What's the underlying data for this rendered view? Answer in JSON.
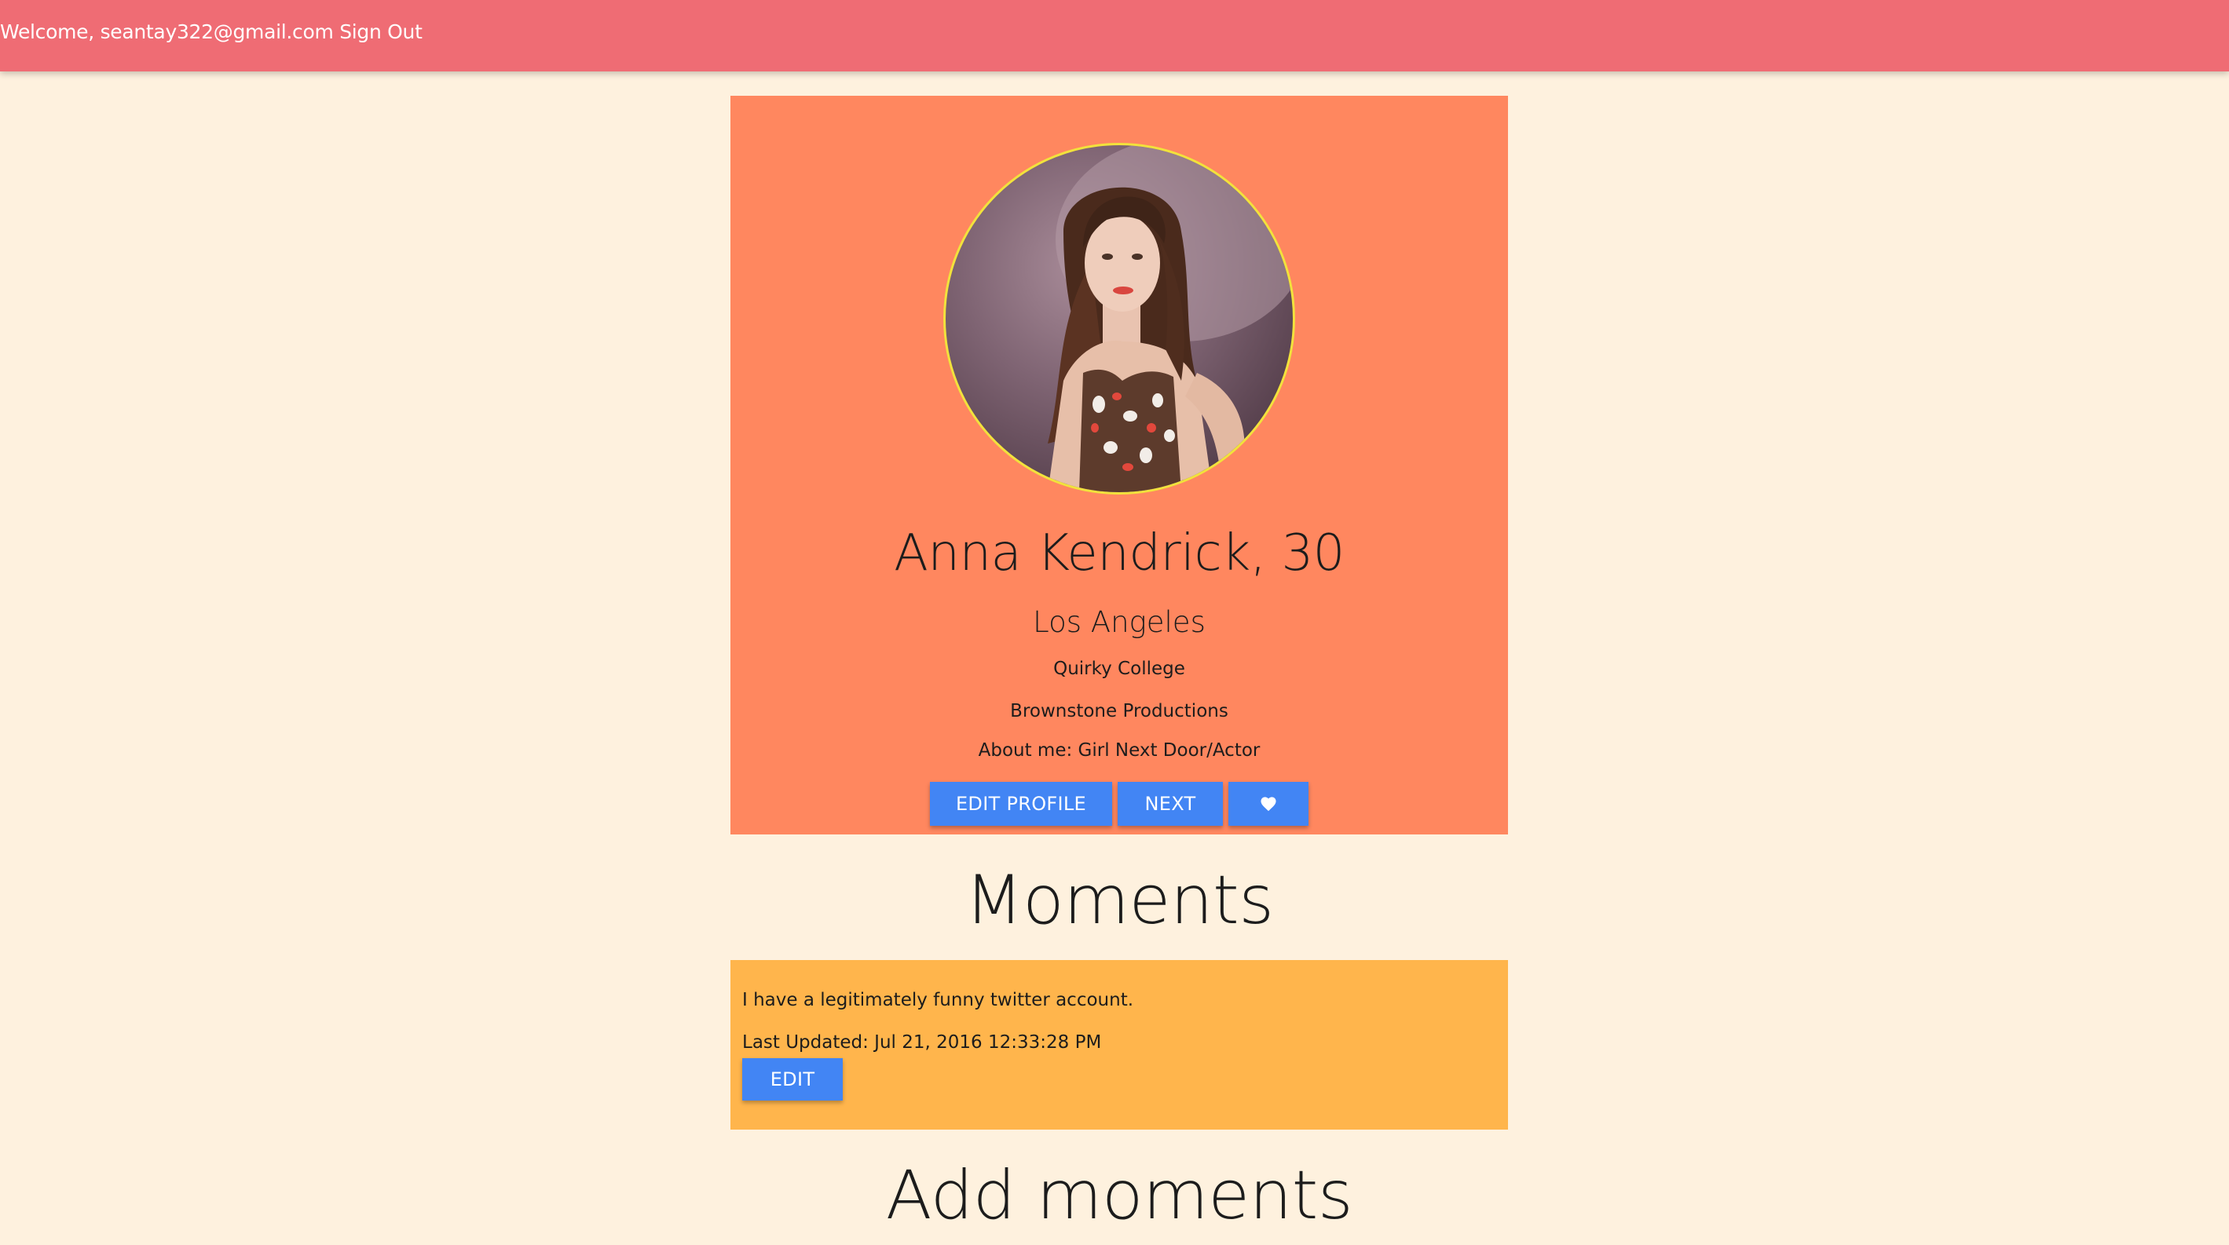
{
  "header": {
    "welcome_prefix": "Welcome,",
    "user_email": "seantay322@gmail.com",
    "sign_out_label": "Sign Out"
  },
  "profile": {
    "name_age": "Anna Kendrick, 30",
    "city": "Los Angeles",
    "school": "Quirky College",
    "work": "Brownstone Productions",
    "about": "About me: Girl Next Door/Actor",
    "buttons": {
      "edit_profile": "EDIT PROFILE",
      "next": "NEXT",
      "like_icon": "heart-icon"
    }
  },
  "moments": {
    "heading": "Moments",
    "items": [
      {
        "text": "I have a legitimately funny twitter account.",
        "last_updated": "Last Updated: Jul 21, 2016 12:33:28 PM",
        "edit_label": "EDIT"
      }
    ]
  },
  "add_moments": {
    "heading": "Add moments"
  },
  "colors": {
    "page_background": "#FEF1DE",
    "topbar": "#EF6C74",
    "profile_card": "#FF875F",
    "moment_card": "#FFB54C",
    "button": "#4285F4",
    "avatar_ring": "#F2E23C"
  }
}
